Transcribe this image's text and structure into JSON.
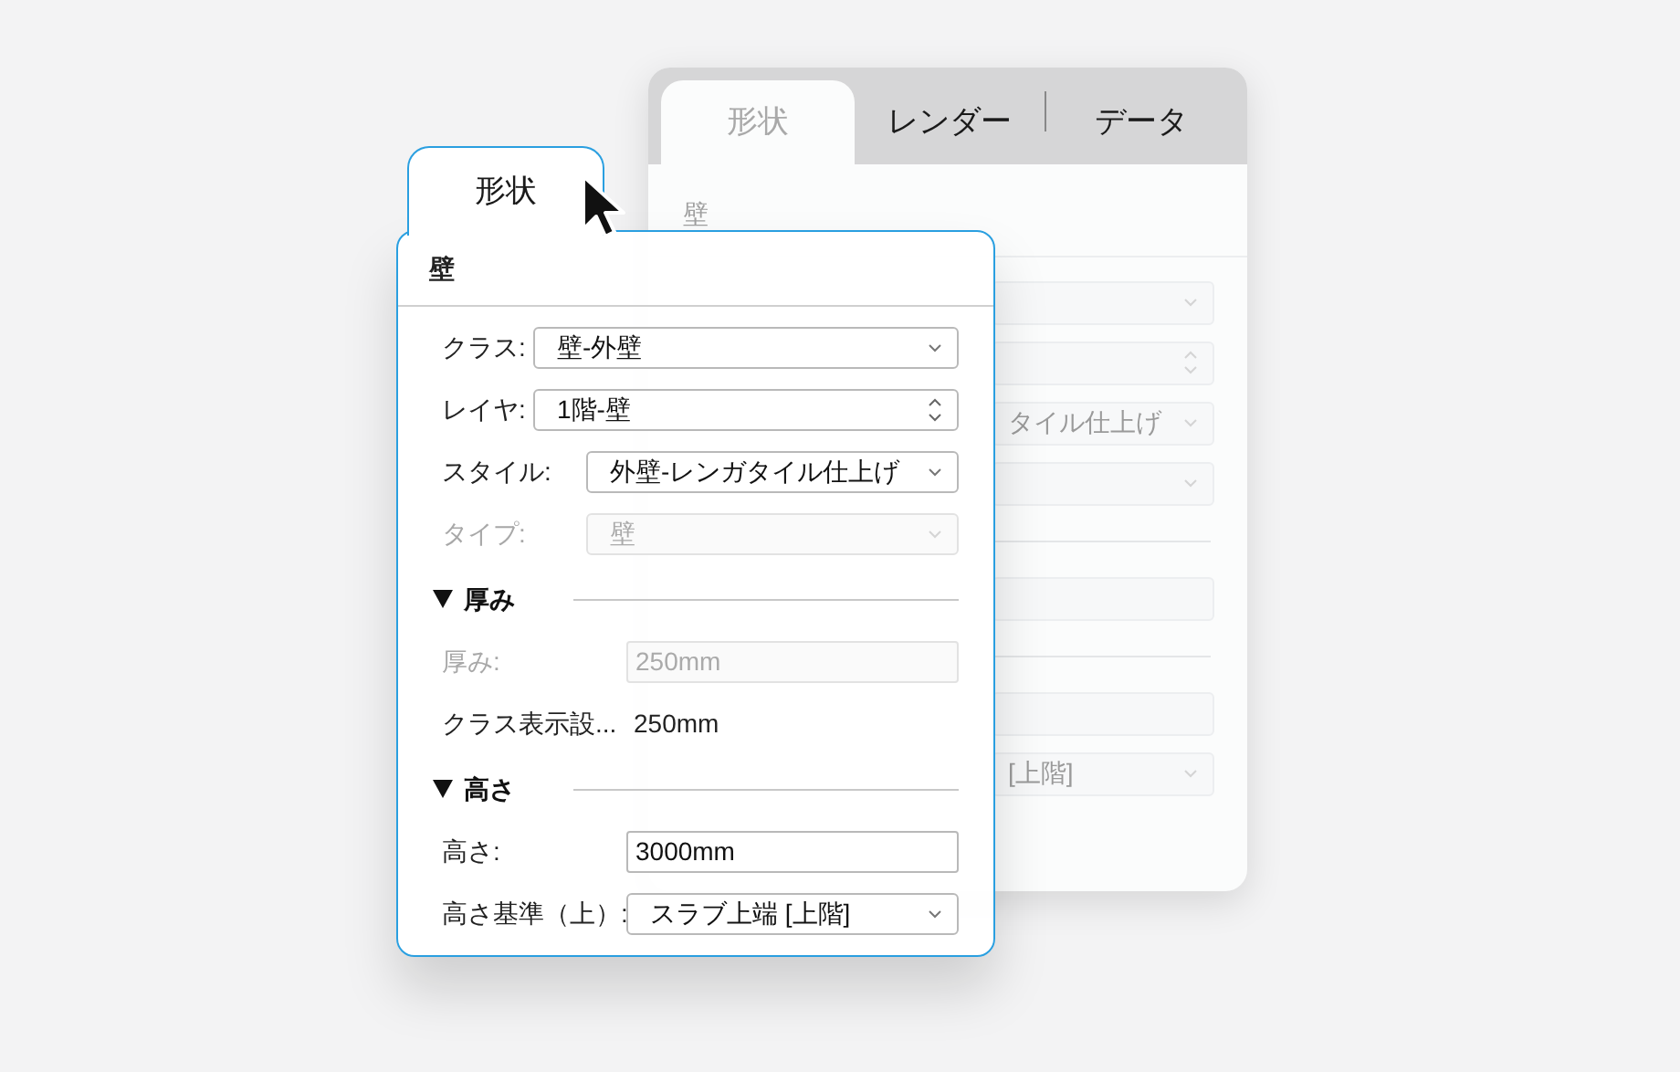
{
  "back_panel": {
    "tabs": [
      {
        "label": "形状",
        "selected": true
      },
      {
        "label": "レンダー",
        "selected": false
      },
      {
        "label": "データ",
        "selected": false
      }
    ],
    "section": "壁",
    "rows": [
      {
        "kind": "select"
      },
      {
        "kind": "stepper"
      },
      {
        "kind": "select",
        "value": "タイル仕上げ"
      },
      {
        "kind": "select"
      },
      {
        "kind": "divider"
      },
      {
        "kind": "field"
      },
      {
        "kind": "divider"
      },
      {
        "kind": "field"
      },
      {
        "kind": "select",
        "value": "[上階]"
      }
    ]
  },
  "front_panel": {
    "tab": {
      "label": "形状",
      "selected": true
    },
    "section": "壁",
    "rows": [
      {
        "kind": "select",
        "label": "クラス:",
        "value": "壁-外壁",
        "disabled": false
      },
      {
        "kind": "stepper",
        "label": "レイヤ:",
        "value": "1階-壁",
        "disabled": false
      },
      {
        "kind": "select",
        "label": "スタイル:",
        "value": "外壁-レンガタイル仕上げ",
        "disabled": false
      },
      {
        "kind": "select",
        "label": "タイプ:",
        "value": "壁",
        "disabled": true
      }
    ],
    "groups": [
      {
        "title": "厚み",
        "expanded": true,
        "rows": [
          {
            "kind": "field",
            "label": "厚み:",
            "value": "250mm",
            "disabled": true
          },
          {
            "kind": "text",
            "label": "クラス表示設...",
            "value": "250mm",
            "disabled": false
          }
        ]
      },
      {
        "title": "高さ",
        "expanded": true,
        "rows": [
          {
            "kind": "field",
            "label": "高さ:",
            "value": "3000mm",
            "disabled": false
          },
          {
            "kind": "select",
            "label": "高さ基準（上）:",
            "value": "スラブ上端 [上階]",
            "disabled": false
          }
        ]
      }
    ]
  }
}
